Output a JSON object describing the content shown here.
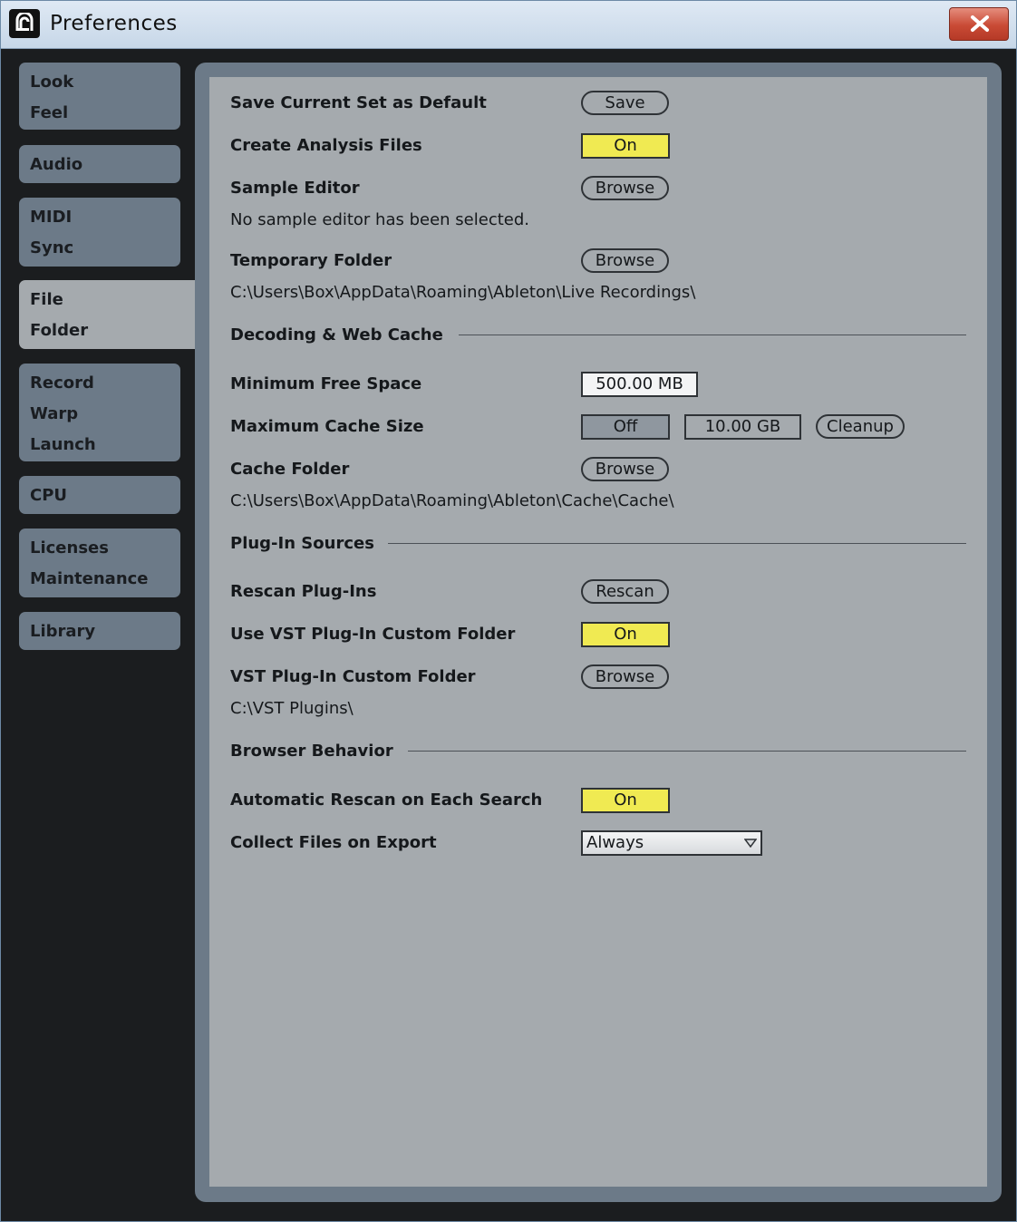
{
  "window": {
    "title": "Preferences"
  },
  "sidebar": {
    "groups": [
      {
        "items": [
          "Look",
          "Feel"
        ]
      },
      {
        "items": [
          "Audio"
        ]
      },
      {
        "items": [
          "MIDI",
          "Sync"
        ]
      },
      {
        "items": [
          "File",
          "Folder"
        ],
        "selected": true
      },
      {
        "items": [
          "Record",
          "Warp",
          "Launch"
        ]
      },
      {
        "items": [
          "CPU"
        ]
      },
      {
        "items": [
          "Licenses",
          "Maintenance"
        ]
      },
      {
        "items": [
          "Library"
        ]
      }
    ]
  },
  "main": {
    "save_default": {
      "label": "Save Current Set as Default",
      "button": "Save"
    },
    "analysis_files": {
      "label": "Create Analysis Files",
      "value": "On"
    },
    "sample_editor": {
      "label": "Sample Editor",
      "button": "Browse",
      "status": "No sample editor has been selected."
    },
    "temp_folder": {
      "label": "Temporary Folder",
      "button": "Browse",
      "path": "C:\\Users\\Box\\AppData\\Roaming\\Ableton\\Live Recordings\\"
    },
    "decoding_section": "Decoding & Web Cache",
    "min_free_space": {
      "label": "Minimum Free Space",
      "value": "500.00 MB"
    },
    "max_cache": {
      "label": "Maximum Cache Size",
      "toggle": "Off",
      "value": "10.00 GB",
      "button": "Cleanup"
    },
    "cache_folder": {
      "label": "Cache Folder",
      "button": "Browse",
      "path": "C:\\Users\\Box\\AppData\\Roaming\\Ableton\\Cache\\Cache\\"
    },
    "plugin_section": "Plug-In Sources",
    "rescan": {
      "label": "Rescan Plug-Ins",
      "button": "Rescan"
    },
    "vst_custom": {
      "label": "Use VST Plug-In Custom Folder",
      "value": "On"
    },
    "vst_folder": {
      "label": "VST Plug-In Custom Folder",
      "button": "Browse",
      "path": "C:\\VST Plugins\\"
    },
    "browser_section": "Browser Behavior",
    "auto_rescan": {
      "label": "Automatic Rescan on Each Search",
      "value": "On"
    },
    "collect_files": {
      "label": "Collect Files on Export",
      "value": "Always"
    }
  },
  "colors": {
    "toggle_on": "#f0ea52",
    "panel_bg": "#a5aaae",
    "nav_bg": "#6c7a88",
    "window_bg": "#1b1d1f",
    "close_button": "#c94a35"
  }
}
